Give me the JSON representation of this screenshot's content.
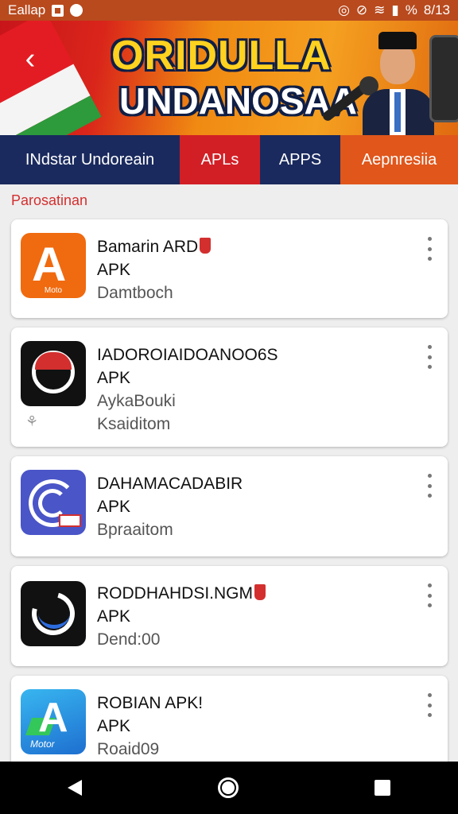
{
  "status_bar": {
    "app_label": "Eallap",
    "time": "8/13",
    "battery": "%"
  },
  "banner": {
    "title_line1": "ORIDULLA",
    "title_line2": "UNDANOSAA",
    "back_glyph": "‹"
  },
  "tabs": [
    {
      "label": "INdstar Undoreain",
      "color": "#1a2a5e"
    },
    {
      "label": "APLs",
      "color": "#d21f26"
    },
    {
      "label": "APPS",
      "color": "#1a2a5e"
    },
    {
      "label": "Aepnresiia",
      "color": "#e0561b"
    }
  ],
  "section_label": "Parosatinan",
  "apps": [
    {
      "name": "Bamarin ARD",
      "type": "APK",
      "line3": "Damtboch",
      "line4": "",
      "icon": "orange-a-icon"
    },
    {
      "name": "IADOROIAIDOANOO6S",
      "type": "APK",
      "line3": "AykaBouki",
      "line4": "Ksaiditom",
      "icon": "black-ring-icon"
    },
    {
      "name": "DAHAMACADABIR",
      "type": "APK",
      "line3": "Bpraaitom",
      "line4": "",
      "icon": "blue-arcs-icon"
    },
    {
      "name": "RODDHAHDSI.NGM",
      "type": "APK",
      "line3": "Dend:00",
      "line4": "",
      "icon": "black-swirl-icon"
    },
    {
      "name": "ROBIAN APK!",
      "type": "APK",
      "line3": "Roaid09",
      "line4": "",
      "icon": "blue-a-icon"
    }
  ],
  "icon_labels": {
    "app1": "Moto",
    "app5": "Motor"
  },
  "accent": {
    "status": "#b84a1e",
    "section": "#d32f2f"
  }
}
